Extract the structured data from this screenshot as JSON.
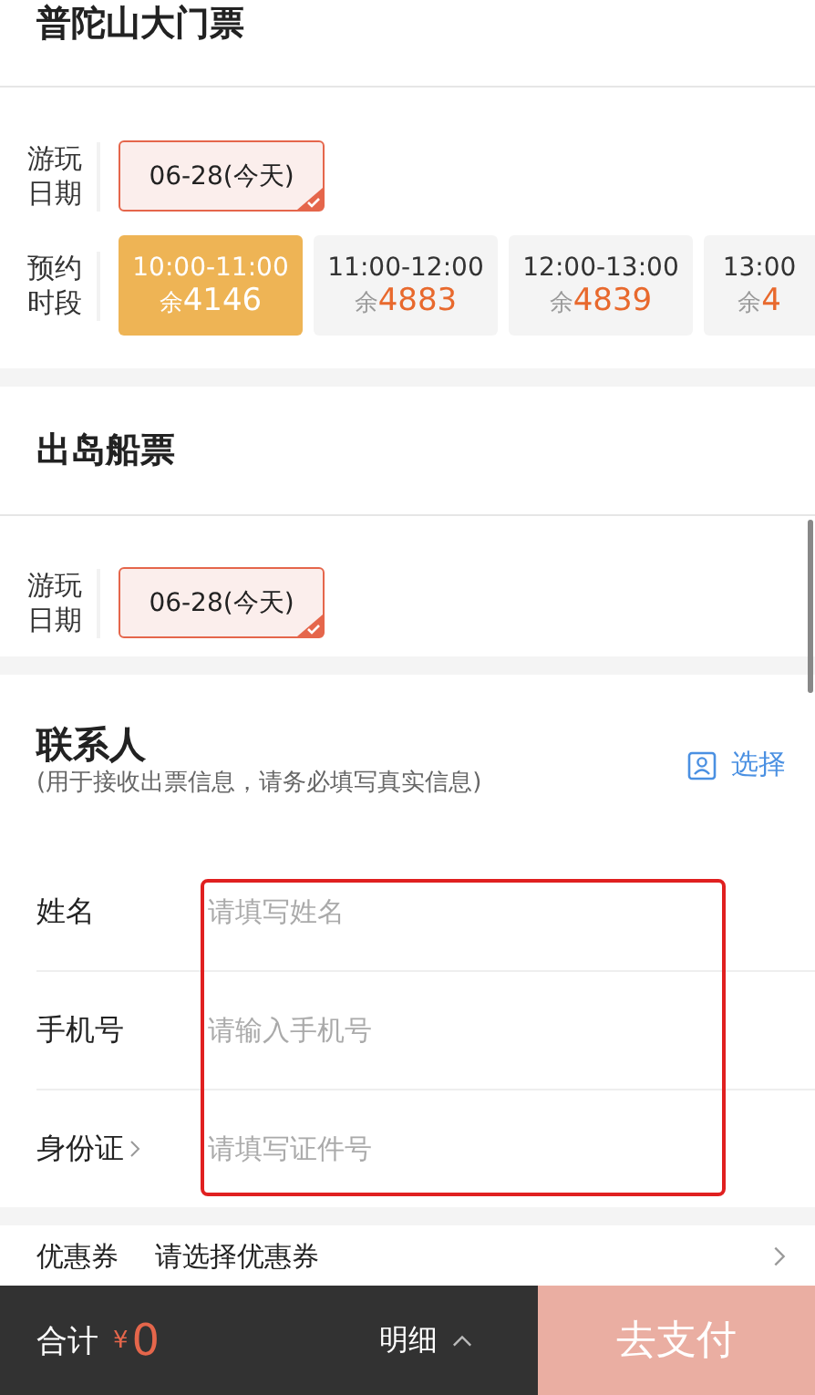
{
  "sections": [
    {
      "title": "普陀山大门票",
      "date": {
        "label": "游玩日期",
        "options": [
          {
            "text": "06-28(今天)",
            "selected": true
          }
        ]
      },
      "slots": {
        "label": "预约时段",
        "options": [
          {
            "time": "10:00-11:00",
            "prefix": "余",
            "count": "4146",
            "selected": true
          },
          {
            "time": "11:00-12:00",
            "prefix": "余",
            "count": "4883",
            "selected": false
          },
          {
            "time": "12:00-13:00",
            "prefix": "余",
            "count": "4839",
            "selected": false
          },
          {
            "time": "13:00",
            "prefix": "余",
            "count": "4",
            "selected": false
          }
        ]
      }
    },
    {
      "title": "出岛船票",
      "date": {
        "label": "游玩日期",
        "options": [
          {
            "text": "06-28(今天)",
            "selected": true
          }
        ]
      }
    }
  ],
  "contact": {
    "title": "联系人",
    "note": "(用于接收出票信息，请务必填写真实信息)",
    "pick": "选择",
    "fields": [
      {
        "label": "姓名",
        "placeholder": "请填写姓名",
        "chevron": false
      },
      {
        "label": "手机号",
        "placeholder": "请输入手机号",
        "chevron": false
      },
      {
        "label": "身份证",
        "placeholder": "请填写证件号",
        "chevron": true
      }
    ]
  },
  "coupon": {
    "label": "优惠券",
    "value": "请选择优惠券"
  },
  "footer": {
    "total_label": "合计",
    "currency": "¥",
    "total": "0",
    "detail": "明细",
    "pay": "去支付"
  }
}
